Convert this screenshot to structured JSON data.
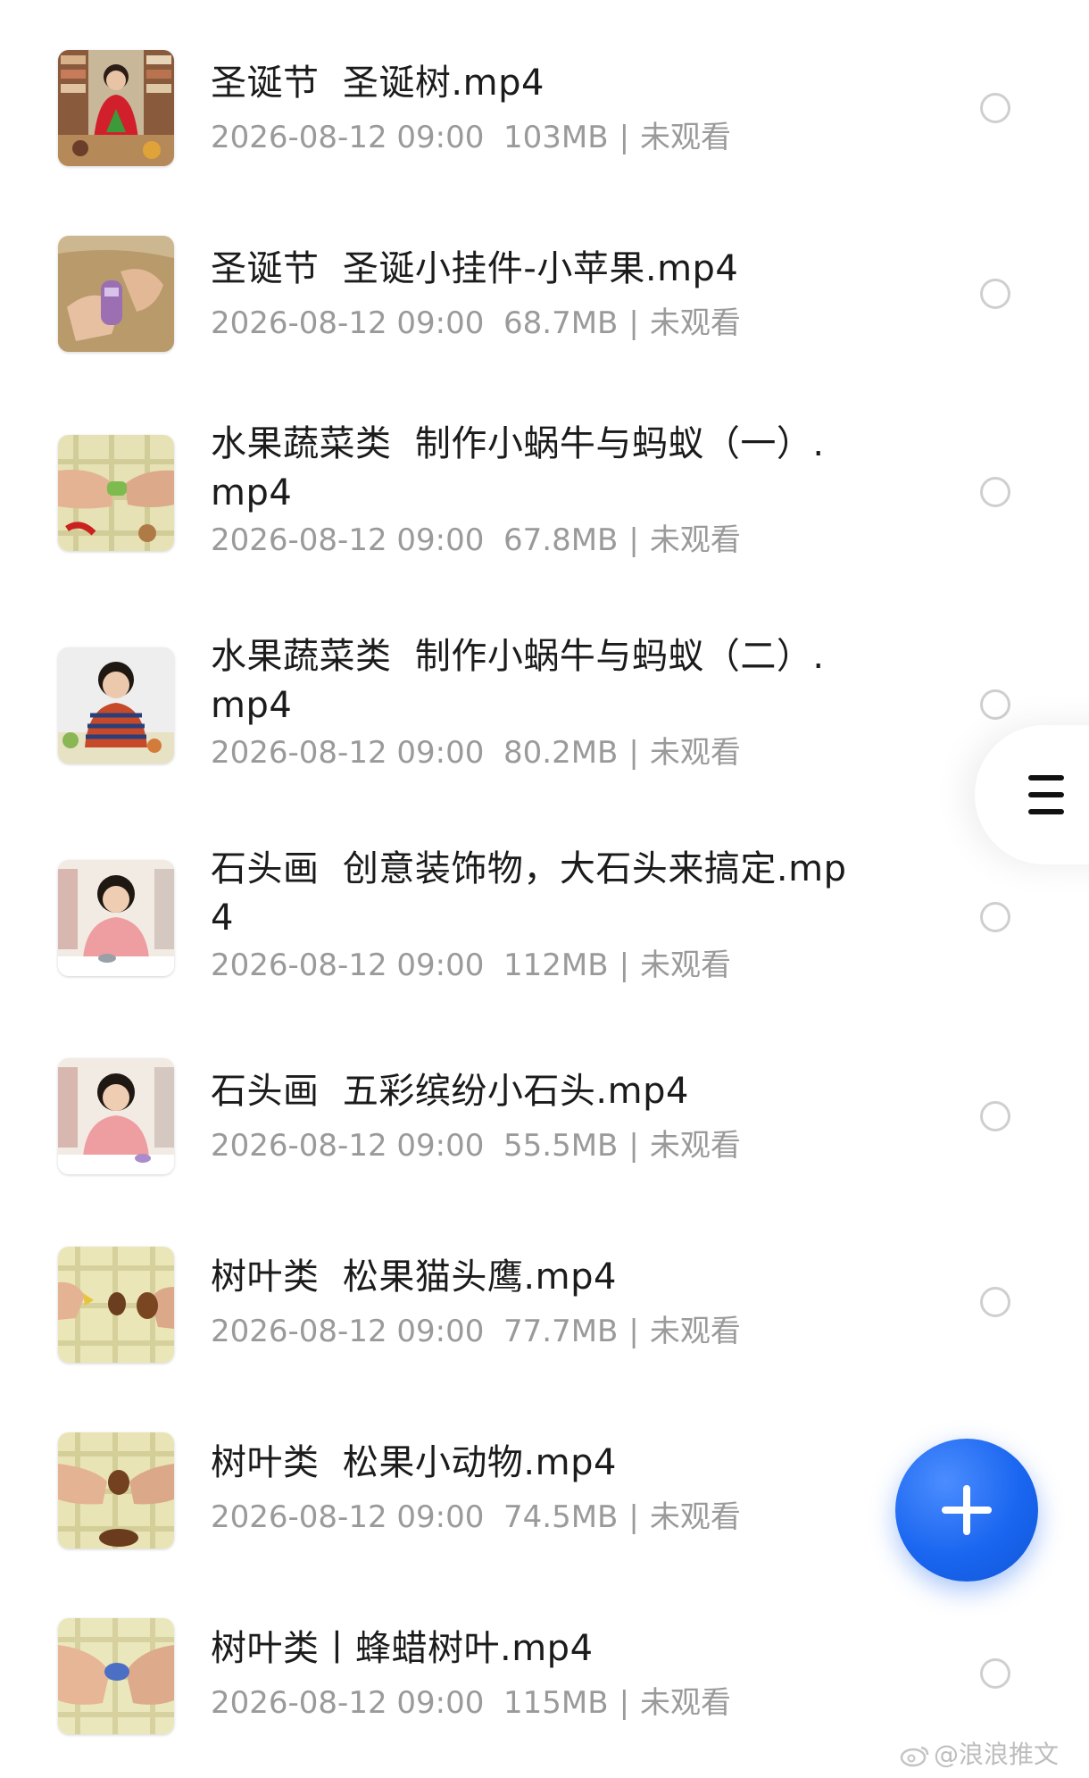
{
  "videos": [
    {
      "title": "圣诞节  圣诞树.mp4",
      "date": "2026-08-12 09:00",
      "size": "103MB",
      "status": "未观看",
      "thumb_icon": "christmas-tree-teacher-thumbnail"
    },
    {
      "title": "圣诞节  圣诞小挂件-小苹果.mp4",
      "date": "2026-08-12 09:00",
      "size": "68.7MB",
      "status": "未观看",
      "thumb_icon": "hands-ornament-thumbnail"
    },
    {
      "title": "水果蔬菜类  制作小蜗牛与蚂蚁（一）.\nmp4",
      "date": "2026-08-12 09:00",
      "size": "67.8MB",
      "status": "未观看",
      "thumb_icon": "hands-clay-thumbnail"
    },
    {
      "title": "水果蔬菜类  制作小蜗牛与蚂蚁（二）.\nmp4",
      "date": "2026-08-12 09:00",
      "size": "80.2MB",
      "status": "未观看",
      "thumb_icon": "teacher-striped-shirt-thumbnail"
    },
    {
      "title": "石头画  创意装饰物，大石头来搞定.mp\n4",
      "date": "2026-08-12 09:00",
      "size": "112MB",
      "status": "未观看",
      "thumb_icon": "teacher-pink-shirt-thumbnail"
    },
    {
      "title": "石头画  五彩缤纷小石头.mp4",
      "date": "2026-08-12 09:00",
      "size": "55.5MB",
      "status": "未观看",
      "thumb_icon": "teacher-pink-shirt-thumbnail"
    },
    {
      "title": "树叶类  松果猫头鹰.mp4",
      "date": "2026-08-12 09:00",
      "size": "77.7MB",
      "status": "未观看",
      "thumb_icon": "pinecone-thumbnail"
    },
    {
      "title": "树叶类  松果小动物.mp4",
      "date": "2026-08-12 09:00",
      "size": "74.5MB",
      "status": "未观看",
      "thumb_icon": "hands-pinecone-thumbnail"
    },
    {
      "title": "树叶类丨蜂蜡树叶.mp4",
      "date": "2026-08-12 09:00",
      "size": "115MB",
      "status": "未观看",
      "thumb_icon": "hands-beeswax-thumbnail"
    }
  ],
  "meta_separator": "|",
  "side_menu_icon": "menu-icon",
  "fab_icon": "plus-icon",
  "watermark": {
    "text": "@浪浪推文",
    "icon": "weibo-icon"
  },
  "colors": {
    "title": "#1b1b1b",
    "meta": "#9a9a9a",
    "radio_border": "#cfcfcf",
    "fab": "#1a66f0"
  }
}
